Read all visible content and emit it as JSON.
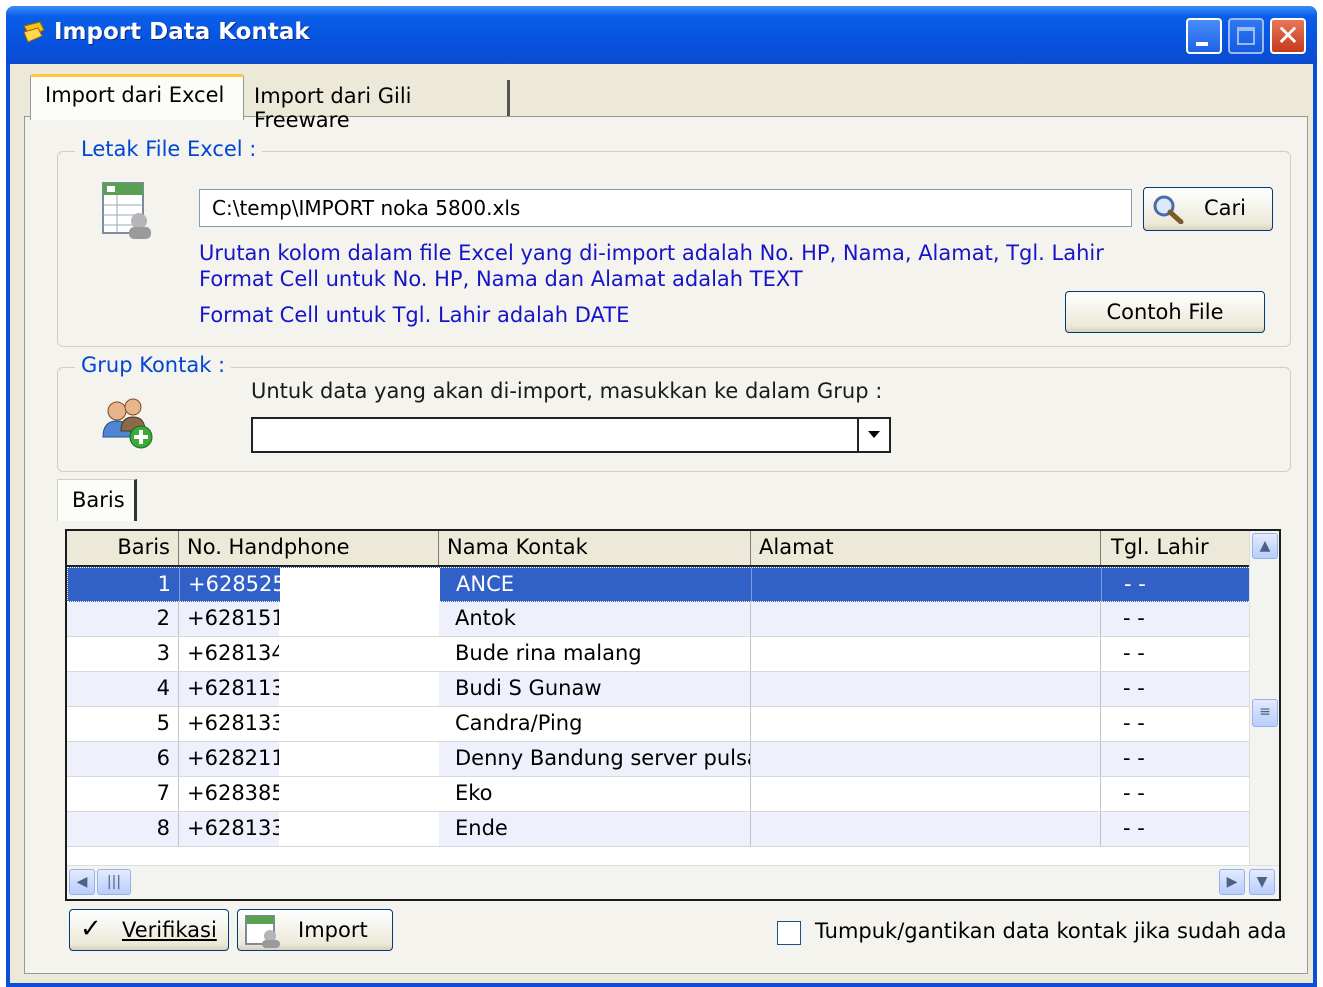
{
  "window": {
    "title": "Import Data Kontak",
    "close_glyph": "✕"
  },
  "tabs": [
    {
      "label": "Import dari Excel"
    },
    {
      "label": "Import dari Gili Freeware"
    }
  ],
  "file_group": {
    "legend": "Letak File Excel :",
    "path_value": "C:\\temp\\IMPORT noka 5800.xls",
    "browse_label": "Cari",
    "info_lines": [
      "Urutan kolom dalam file Excel yang di-import adalah No. HP, Nama, Alamat, Tgl. Lahir",
      "Format Cell untuk No. HP, Nama dan Alamat adalah TEXT",
      "Format Cell untuk Tgl. Lahir adalah DATE"
    ],
    "sample_label": "Contoh File"
  },
  "group_section": {
    "legend": "Grup Kontak :",
    "instruction": "Untuk data yang akan di-import, masukkan ke dalam Grup :",
    "selected_group": ""
  },
  "grid": {
    "tab_label": "Baris",
    "columns": [
      "Baris",
      "No. Handphone",
      "Nama Kontak",
      "Alamat",
      "Tgl. Lahir"
    ],
    "rows": [
      {
        "baris": "1",
        "hp": "+628525",
        "nama": "ANCE",
        "alamat": "",
        "tgl": "-  -"
      },
      {
        "baris": "2",
        "hp": "+628151",
        "nama": "Antok",
        "alamat": "",
        "tgl": "-  -"
      },
      {
        "baris": "3",
        "hp": "+628134",
        "nama": "Bude rina malang",
        "alamat": "",
        "tgl": "-  -"
      },
      {
        "baris": "4",
        "hp": "+628113",
        "nama": "Budi S Gunaw",
        "alamat": "",
        "tgl": "-  -"
      },
      {
        "baris": "5",
        "hp": "+628133",
        "nama": "Candra/Ping",
        "alamat": "",
        "tgl": "-  -"
      },
      {
        "baris": "6",
        "hp": "+628211",
        "nama": "Denny Bandung server pulsa",
        "alamat": "",
        "tgl": "-  -"
      },
      {
        "baris": "7",
        "hp": "+628385",
        "nama": "Eko",
        "alamat": "",
        "tgl": "-  -"
      },
      {
        "baris": "8",
        "hp": "+628133",
        "nama": "Ende",
        "alamat": "",
        "tgl": "-  -"
      }
    ],
    "selected_row": 1
  },
  "footer": {
    "verify_label": "Verifikasi",
    "verify_glyph": "✓",
    "import_label": "Import",
    "overwrite_label": "Tumpuk/gantikan data kontak jika sudah ada",
    "overwrite_checked": false
  },
  "colors": {
    "title_bar": "#0753e0",
    "selection": "#3161c6",
    "info_text": "#1515c8",
    "legend_text": "#0046d5"
  }
}
